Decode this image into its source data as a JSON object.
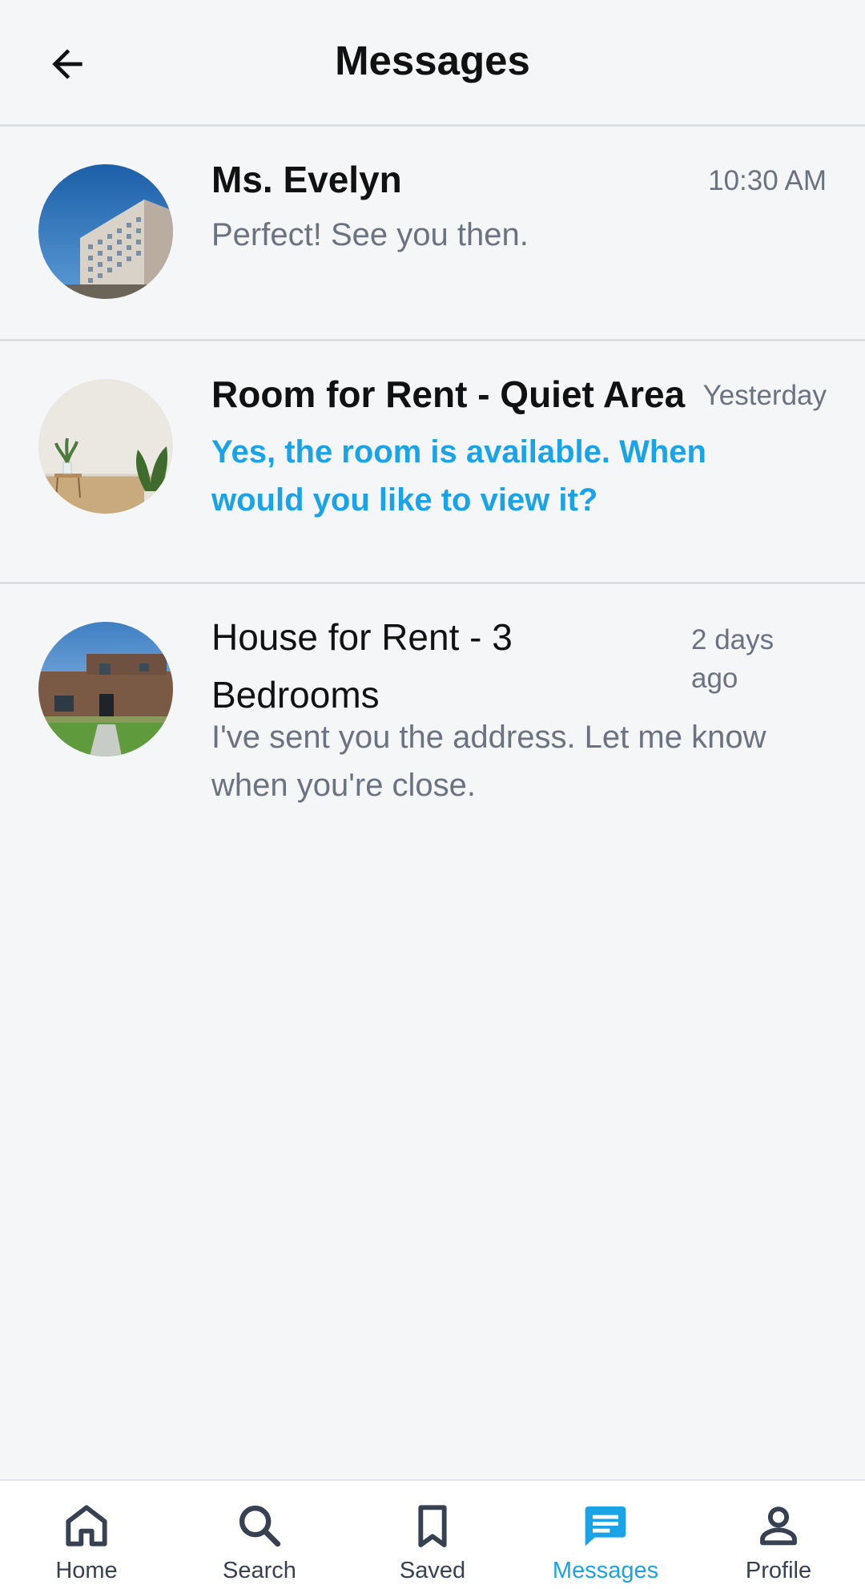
{
  "header": {
    "title": "Messages",
    "back_icon": "arrow-left-icon"
  },
  "conversations": [
    {
      "name": "Ms. Evelyn",
      "time": "10:30 AM",
      "preview": "Perfect! See you then.",
      "unread": false,
      "avatar": "apartment-building-photo"
    },
    {
      "name": "Room for Rent - Quiet Area",
      "time": "Yesterday",
      "preview": "Yes, the room is available. When would you like to view it?",
      "unread": true,
      "avatar": "room-interior-photo"
    },
    {
      "name": "House for Rent - 3 Bedrooms",
      "time": "2 days ago",
      "preview": "I've sent you the address. Let me know when you're close.",
      "unread": false,
      "avatar": "house-exterior-photo"
    }
  ],
  "colors": {
    "accent": "#1aa3e6",
    "muted_text": "#6b7280",
    "background": "#f5f6f8",
    "divider": "#dcdfe3"
  },
  "bottom_nav": {
    "active": "messages",
    "items": [
      {
        "key": "home",
        "label": "Home",
        "icon": "home-icon"
      },
      {
        "key": "search",
        "label": "Search",
        "icon": "search-icon"
      },
      {
        "key": "saved",
        "label": "Saved",
        "icon": "bookmark-icon"
      },
      {
        "key": "messages",
        "label": "Messages",
        "icon": "chat-icon"
      },
      {
        "key": "profile",
        "label": "Profile",
        "icon": "person-icon"
      }
    ]
  }
}
